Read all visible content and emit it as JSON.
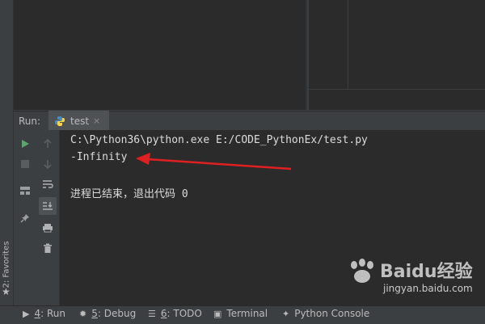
{
  "run": {
    "label": "Run:",
    "tab": {
      "name": "test",
      "close": "×"
    }
  },
  "console": {
    "lines": [
      "C:\\Python36\\python.exe E:/CODE_PythonEx/test.py",
      "-Infinity",
      "",
      "进程已结束，退出代码 0"
    ]
  },
  "sidebar": {
    "favorites": "2: Favorites",
    "star": "★"
  },
  "bottom_bar": {
    "run": {
      "num": "4",
      "label": ": Run"
    },
    "debug": {
      "num": "5",
      "label": ": Debug"
    },
    "todo": {
      "num": "6",
      "label": ": TODO"
    },
    "terminal": {
      "label": "Terminal"
    },
    "python_console": {
      "label": "Python Console"
    }
  },
  "watermark": {
    "logo": "Baidu经验",
    "url": "jingyan.baidu.com"
  },
  "colors": {
    "annotation_arrow": "#e02020",
    "run_green": "#59a869",
    "console_bg": "#2b2b2b",
    "panel_bg": "#3c3f41"
  },
  "icons": [
    "run-icon",
    "stop-icon",
    "up-arrow-icon",
    "down-arrow-icon",
    "soft-wrap-icon",
    "scroll-to-end-icon",
    "print-icon",
    "trash-icon",
    "layout-icon",
    "pin-icon",
    "python-icon"
  ]
}
